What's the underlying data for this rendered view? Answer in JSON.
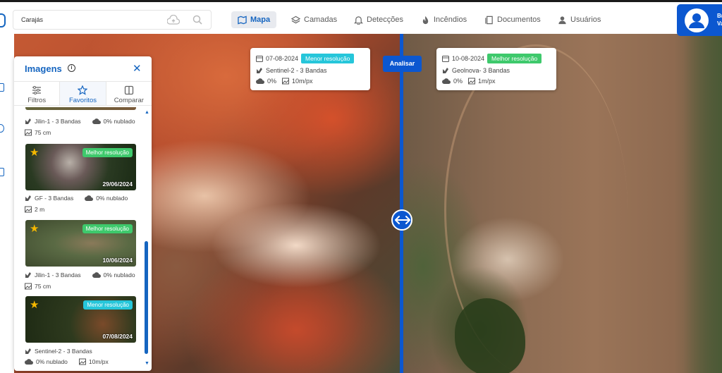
{
  "search": {
    "value": "Carajás"
  },
  "nav": [
    {
      "label": "Mapa",
      "icon": "map-icon",
      "active": true
    },
    {
      "label": "Camadas",
      "icon": "layers-icon"
    },
    {
      "label": "Detecções",
      "icon": "bell-icon"
    },
    {
      "label": "Incêndios",
      "icon": "fire-icon"
    },
    {
      "label": "Documentos",
      "icon": "document-icon"
    },
    {
      "label": "Usuários",
      "icon": "user-icon"
    }
  ],
  "user": {
    "name_line1": "Br",
    "name_line2": "Va"
  },
  "map": {
    "analyze_label": "Analisar",
    "left_card": {
      "date": "07-08-2024",
      "badge": "Menor resolução",
      "sensor": "Sentinel-2 - 3 Bandas",
      "cloud": "0%",
      "resolution": "10m/px"
    },
    "right_card": {
      "date": "10-08-2024",
      "badge": "Melhor resolução",
      "sensor": "Geolnova- 3 Bandas",
      "cloud": "0%",
      "resolution": "1m/px"
    }
  },
  "panel": {
    "title": "Imagens",
    "tabs": [
      {
        "label": "Filtros",
        "icon": "filter-icon"
      },
      {
        "label": "Favoritos",
        "icon": "star-outline-icon",
        "active": true
      },
      {
        "label": "Comparar",
        "icon": "compare-icon"
      }
    ],
    "items": [
      {
        "sensor": "Jilin-1 - 3 Bandas",
        "cloud": "0% nublado",
        "resolution": "75 cm"
      },
      {
        "badge": "Melhor resolução",
        "date": "29/06/2024",
        "sensor": "GF - 3 Bandas",
        "cloud": "0% nublado",
        "resolution": "2 m"
      },
      {
        "badge": "Melhor resolução",
        "date": "10/06/2024",
        "sensor": "Jilin-1 - 3 Bandas",
        "cloud": "0% nublado",
        "resolution": "75 cm"
      },
      {
        "badge": "Menor resolução",
        "date": "07/08/2024",
        "sensor": "Sentinel-2 - 3 Bandas",
        "cloud": "0% nublado",
        "resolution": "10m/px"
      }
    ]
  },
  "colors": {
    "primary": "#0b57d0",
    "accent_text": "#1565c0",
    "best_badge": "#3ec96c",
    "worst_badge": "#26c6da",
    "star": "#f5b800"
  }
}
